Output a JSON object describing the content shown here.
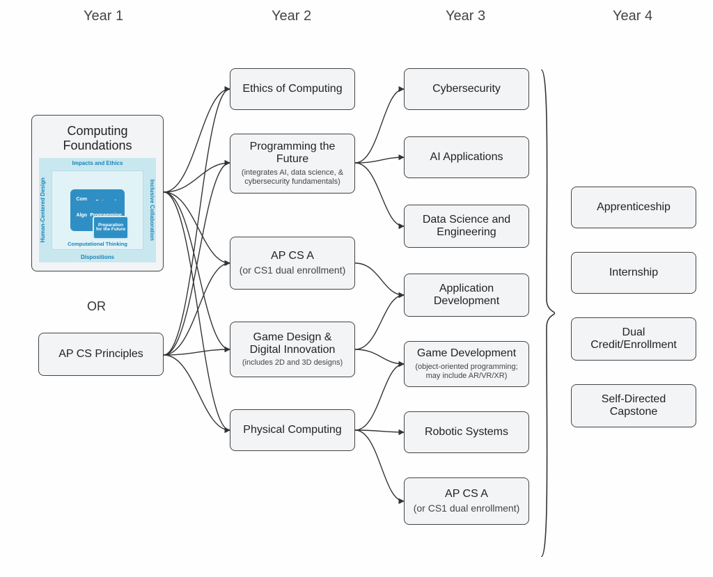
{
  "headers": {
    "y1": "Year 1",
    "y2": "Year 2",
    "y3": "Year 3",
    "y4": "Year 4"
  },
  "or_label": "OR",
  "year1": {
    "cf": {
      "title": "Computing Foundations",
      "figure": {
        "top": "Impacts and Ethics",
        "left": "Human-Centered Design",
        "right": "Inclusive Collaboration",
        "inner_bottom": "Computational Thinking",
        "outer_bottom": "Dispositions",
        "q1": "Computing Systems and Security",
        "q2": "Data and Analysis",
        "q3": "Algorithms",
        "q4": "Programming",
        "center": "Preparation for the Future"
      }
    },
    "apcsp": {
      "title": "AP CS Principles"
    }
  },
  "year2": {
    "ethics": {
      "title": "Ethics of Computing"
    },
    "prog_future": {
      "title": "Programming the Future",
      "sub": "(integrates AI, data science, & cybersecurity fundamentals)"
    },
    "apcsa": {
      "title": "AP CS A",
      "sub": "(or CS1 dual enrollment)"
    },
    "game": {
      "title": "Game Design & Digital Innovation",
      "sub": "(includes 2D and 3D designs)"
    },
    "physical": {
      "title": "Physical Computing"
    }
  },
  "year3": {
    "cyber": {
      "title": "Cybersecurity"
    },
    "ai": {
      "title": "AI Applications"
    },
    "data": {
      "title": "Data Science and Engineering"
    },
    "appdev": {
      "title": "Application Development"
    },
    "gamedev": {
      "title": "Game Development",
      "sub": "(object-oriented programming; may include AR/VR/XR)"
    },
    "robotics": {
      "title": "Robotic Systems"
    },
    "apcsa": {
      "title": "AP CS A",
      "sub": "(or CS1 dual enrollment)"
    }
  },
  "year4": {
    "apprentice": {
      "title": "Apprenticeship"
    },
    "intern": {
      "title": "Internship"
    },
    "dual": {
      "title": "Dual Credit/Enrollment"
    },
    "capstone": {
      "title": "Self-Directed Capstone"
    }
  },
  "edges": [
    {
      "from": "cf",
      "to": "ethics"
    },
    {
      "from": "cf",
      "to": "prog_future"
    },
    {
      "from": "cf",
      "to": "apcsa2"
    },
    {
      "from": "cf",
      "to": "game"
    },
    {
      "from": "cf",
      "to": "physical"
    },
    {
      "from": "apcsp",
      "to": "ethics"
    },
    {
      "from": "apcsp",
      "to": "prog_future"
    },
    {
      "from": "apcsp",
      "to": "apcsa2"
    },
    {
      "from": "apcsp",
      "to": "game"
    },
    {
      "from": "apcsp",
      "to": "physical"
    },
    {
      "from": "prog_future",
      "to": "cyber"
    },
    {
      "from": "prog_future",
      "to": "ai"
    },
    {
      "from": "prog_future",
      "to": "data"
    },
    {
      "from": "apcsa2",
      "to": "appdev"
    },
    {
      "from": "game",
      "to": "appdev"
    },
    {
      "from": "game",
      "to": "gamedev"
    },
    {
      "from": "physical",
      "to": "gamedev"
    },
    {
      "from": "physical",
      "to": "robotics"
    },
    {
      "from": "physical",
      "to": "apcsa3"
    }
  ]
}
